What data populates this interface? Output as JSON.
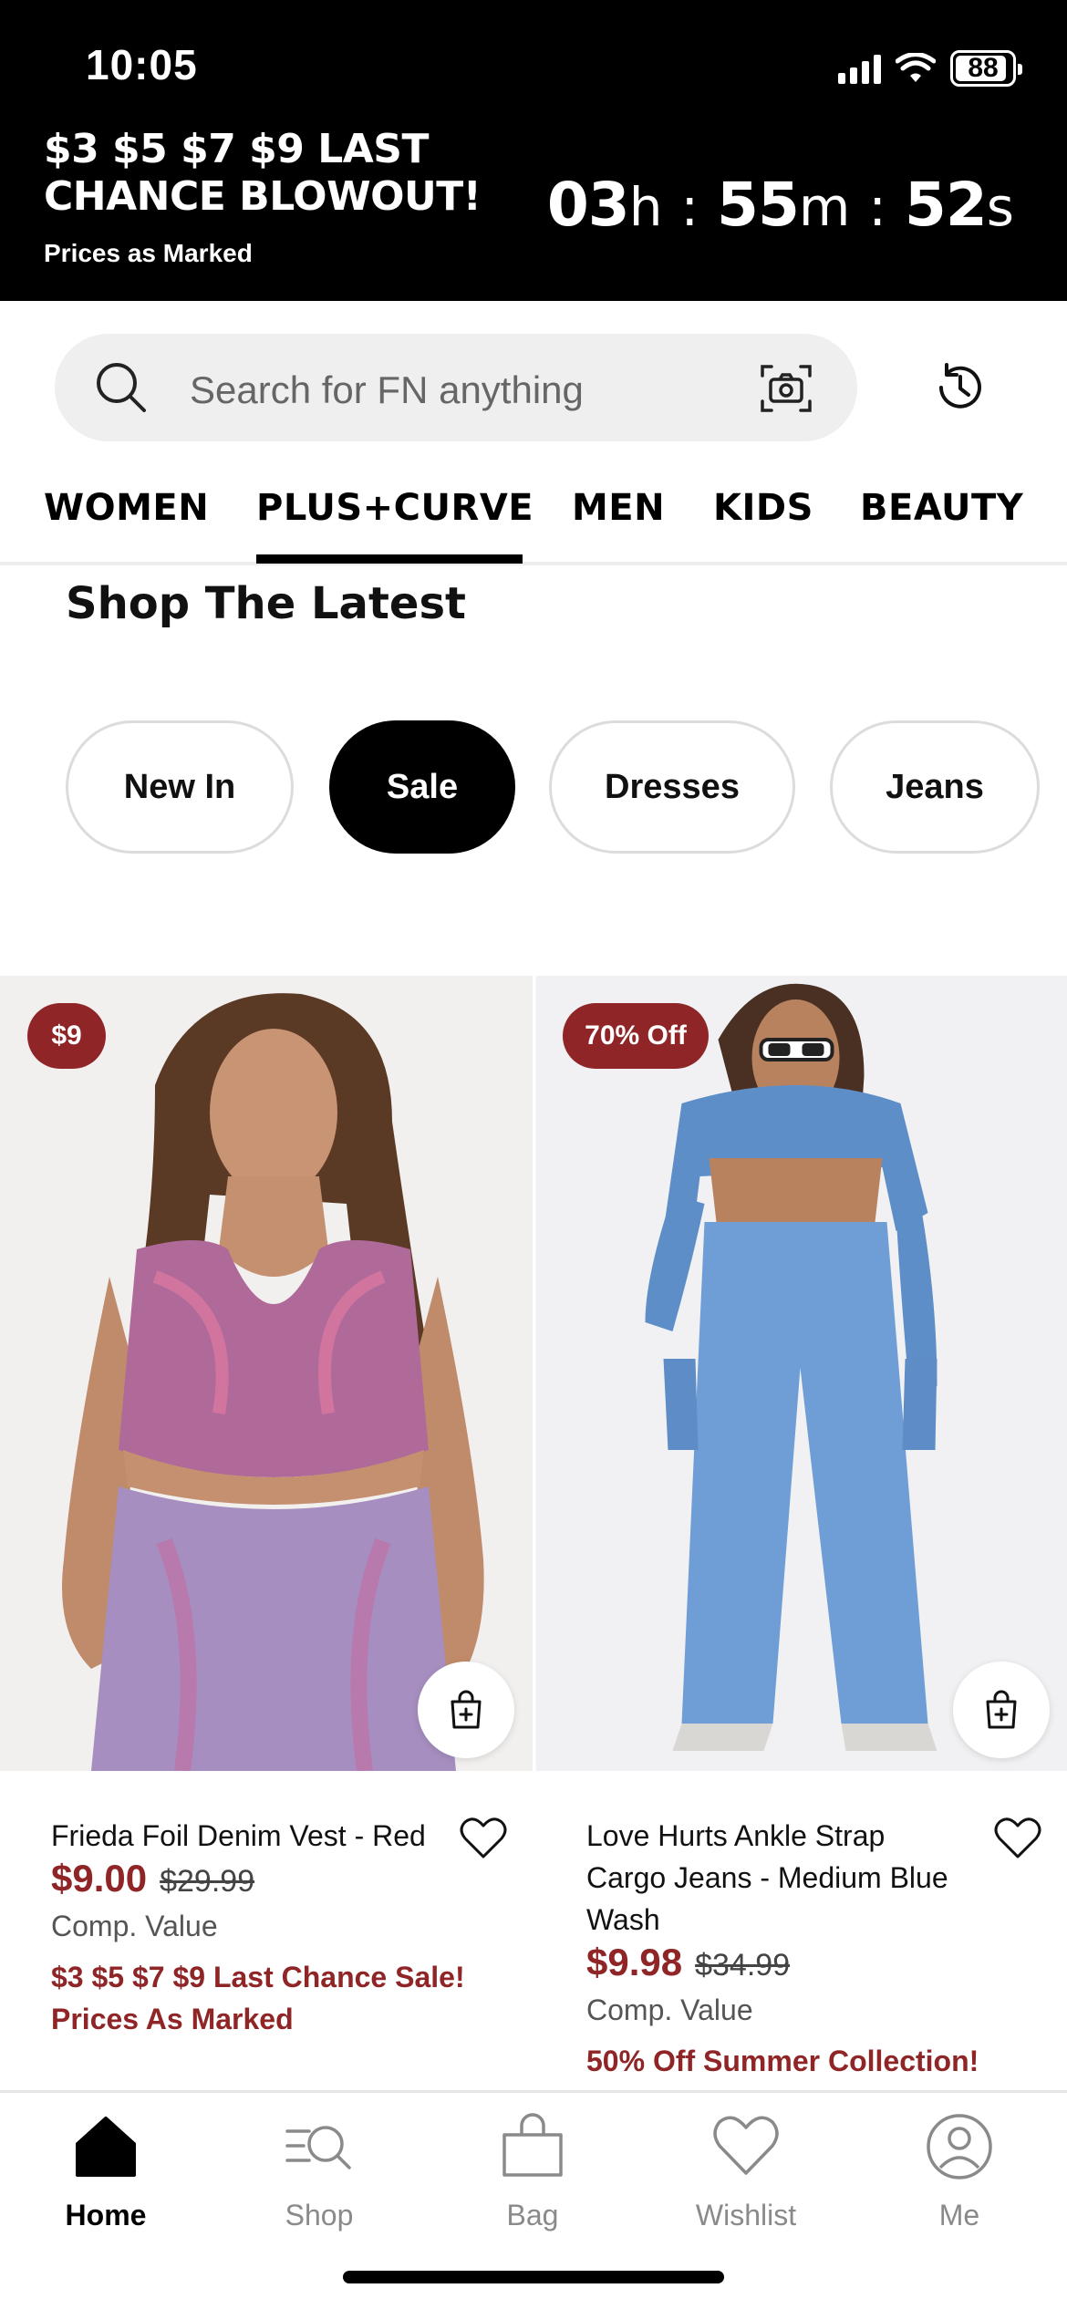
{
  "status_bar": {
    "time": "10:05",
    "battery": "88"
  },
  "promo_banner": {
    "title": "$3 $5 $7 $9 LAST CHANCE BLOWOUT!",
    "subtitle": "Prices as Marked",
    "countdown": {
      "hours": "03",
      "hours_unit": "h",
      "minutes": "55",
      "minutes_unit": "m",
      "seconds": "52",
      "seconds_unit": "s",
      "separator": ":"
    }
  },
  "search": {
    "placeholder": "Search for FN anything"
  },
  "category_tabs": [
    {
      "label": "WOMEN"
    },
    {
      "label": "PLUS+CURVE",
      "active": true
    },
    {
      "label": "MEN"
    },
    {
      "label": "KIDS"
    },
    {
      "label": "BEAUTY"
    }
  ],
  "section": {
    "title": "Shop The Latest",
    "chips": [
      {
        "label": "New In"
      },
      {
        "label": "Sale",
        "active": true
      },
      {
        "label": "Dresses"
      },
      {
        "label": "Jeans"
      }
    ]
  },
  "products": [
    {
      "badge": "$9",
      "name": "Frieda Foil Denim Vest - Red",
      "price": "$9.00",
      "original_price": "$29.99",
      "comp_label": "Comp. Value",
      "promo_line1": "$3 $5 $7 $9 Last Chance Sale!",
      "promo_line2": "Prices As Marked"
    },
    {
      "badge": "70% Off",
      "name": "Love Hurts Ankle Strap Cargo Jeans - Medium Blue Wash",
      "price": "$9.98",
      "original_price": "$34.99",
      "comp_label": "Comp. Value",
      "promo_line1": "50% Off Summer Collection!"
    }
  ],
  "bottom_nav": [
    {
      "label": "Home",
      "icon": "home-icon",
      "active": true
    },
    {
      "label": "Shop",
      "icon": "shop-search-icon"
    },
    {
      "label": "Bag",
      "icon": "bag-icon"
    },
    {
      "label": "Wishlist",
      "icon": "heart-icon"
    },
    {
      "label": "Me",
      "icon": "profile-icon"
    }
  ],
  "colors": {
    "brand_red": "#8f2526",
    "black": "#000000",
    "search_bg": "#efefef"
  }
}
